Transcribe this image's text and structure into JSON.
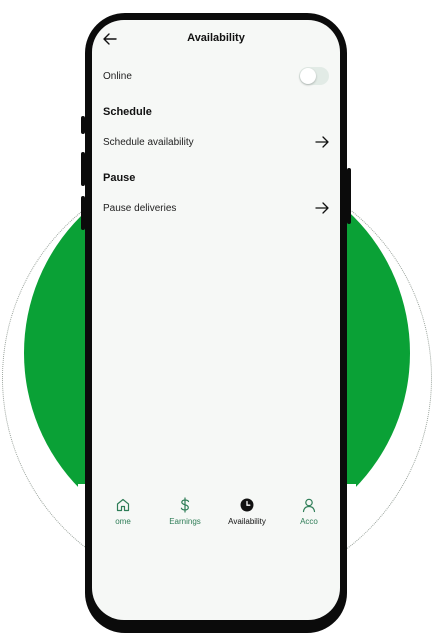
{
  "colors": {
    "brand_green": "#0aa136",
    "tab_inactive": "#2e7d57",
    "tab_active": "#111111",
    "screen_bg": "#f6f8f6"
  },
  "header": {
    "title": "Availability",
    "back_icon": "arrow-left-icon"
  },
  "online": {
    "label": "Online",
    "toggle_on": false
  },
  "schedule": {
    "title": "Schedule",
    "item_label": "Schedule availability"
  },
  "pause": {
    "title": "Pause",
    "item_label": "Pause deliveries"
  },
  "tabs": [
    {
      "label": "ome",
      "icon": "home-icon",
      "active": false
    },
    {
      "label": "Earnings",
      "icon": "dollar-icon",
      "active": false
    },
    {
      "label": "Availability",
      "icon": "clock-icon",
      "active": true
    },
    {
      "label": "Acco",
      "icon": "account-icon",
      "active": false
    }
  ]
}
